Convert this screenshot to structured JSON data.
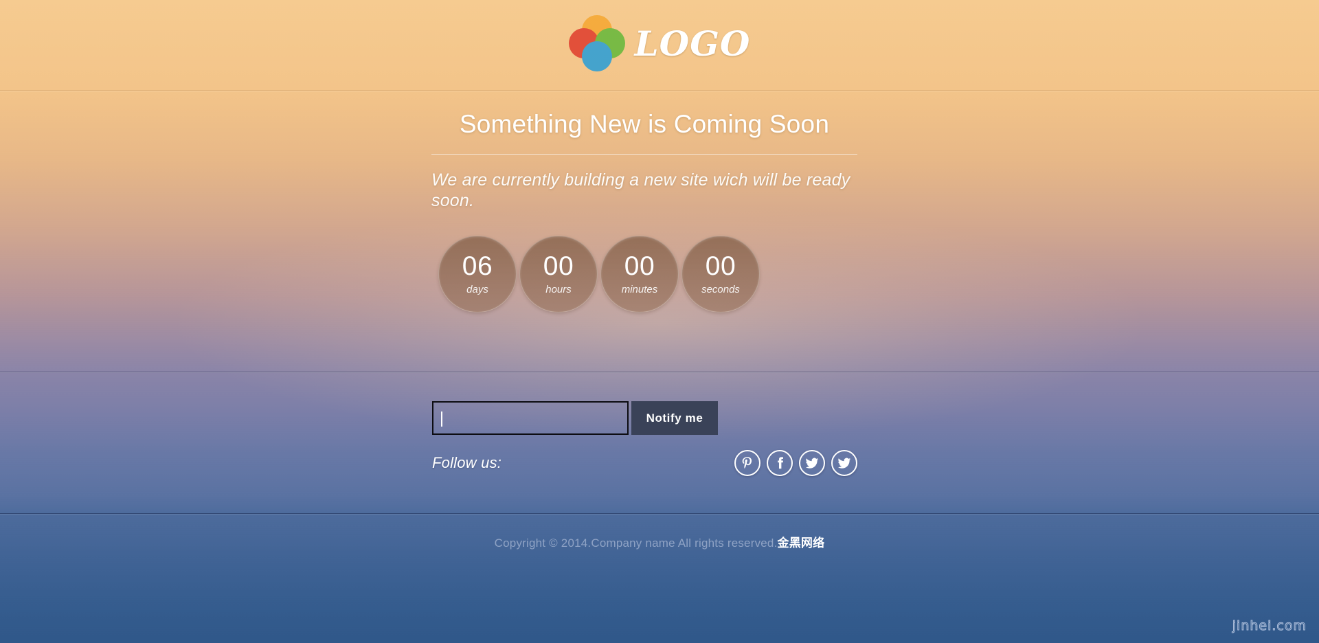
{
  "header": {
    "logo_text": "LOGO",
    "logo_icon": "four-overlapping-circles-logo",
    "logo_colors": {
      "top": "#f5a833",
      "left": "#e0402f",
      "right": "#68b93c",
      "bottom": "#2e9fd6"
    }
  },
  "hero": {
    "title": "Something New is Coming Soon",
    "subtitle": "We are currently building a new site wich will be ready soon."
  },
  "countdown": {
    "units": [
      {
        "value": "06",
        "label": "days"
      },
      {
        "value": "00",
        "label": "hours"
      },
      {
        "value": "00",
        "label": "minutes"
      },
      {
        "value": "00",
        "label": "seconds"
      }
    ]
  },
  "subscribe": {
    "email_value": "",
    "email_placeholder": "",
    "button_label": "Notify me",
    "follow_label": "Follow us:",
    "social": [
      {
        "name": "pinterest",
        "icon": "pinterest-icon"
      },
      {
        "name": "facebook",
        "icon": "facebook-icon"
      },
      {
        "name": "twitter",
        "icon": "twitter-icon"
      },
      {
        "name": "twitter-alt",
        "icon": "twitter-icon"
      }
    ]
  },
  "footer": {
    "copyright": "Copyright © 2014.Company name All rights reserved.",
    "brand_cn": "金黑网络"
  },
  "watermark": {
    "text": "jinhei.com"
  },
  "colors": {
    "background_top": "#f6cb90",
    "background_mid": "#8a84a8",
    "background_bottom": "#2f5789",
    "button_bg": "#3a4258",
    "countdown_circle": "#8a6652"
  }
}
